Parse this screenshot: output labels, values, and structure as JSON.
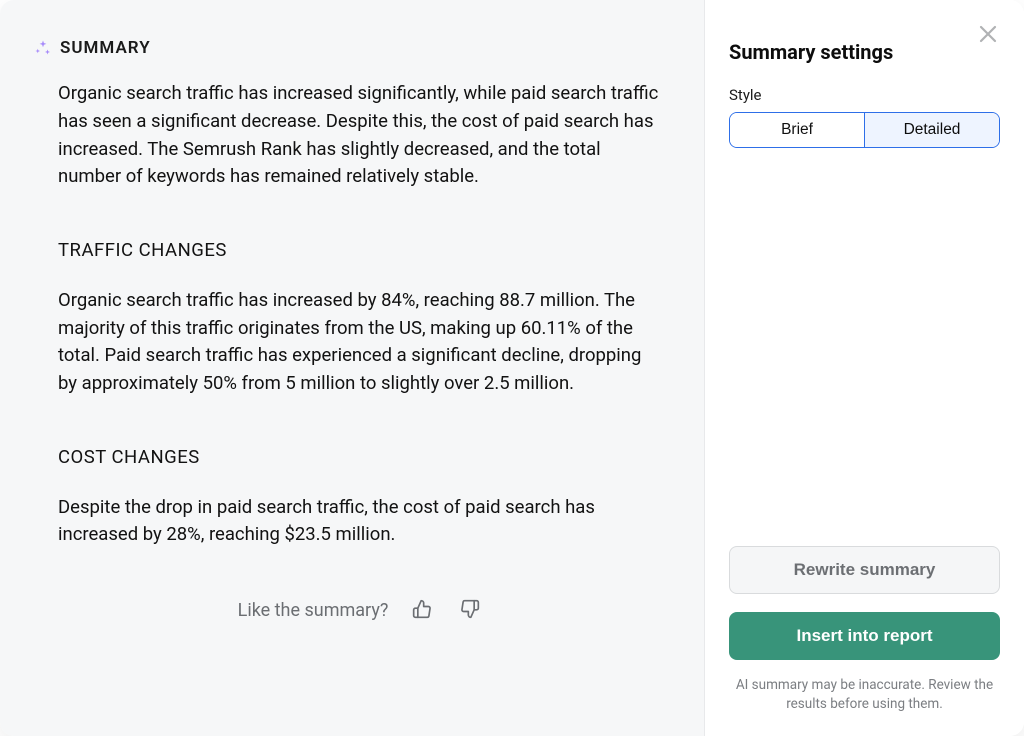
{
  "summary": {
    "title": "SUMMARY",
    "intro": "Organic search traffic has increased significantly, while paid search traffic has seen a significant decrease. Despite this, the cost of paid search has increased. The Semrush Rank has slightly decreased, and the total number of keywords has remained relatively stable.",
    "traffic_heading": "TRAFFIC CHANGES",
    "traffic_body": "Organic search traffic has increased by 84%, reaching 88.7 million. The majority of this traffic originates from the US, making up 60.11% of the total. Paid search traffic has experienced a significant decline, dropping by approximately 50% from 5 million to slightly over 2.5 million.",
    "cost_heading": "COST CHANGES",
    "cost_body": "Despite the drop in paid search traffic, the cost of paid search has increased by 28%, reaching $23.5 million."
  },
  "feedback": {
    "prompt": "Like the summary?"
  },
  "settings": {
    "title": "Summary settings",
    "style_label": "Style",
    "option_brief": "Brief",
    "option_detailed": "Detailed",
    "selected_style": "Detailed",
    "rewrite_label": "Rewrite summary",
    "insert_label": "Insert into report",
    "disclaimer": "AI summary may be inaccurate. Review the results before using them."
  }
}
